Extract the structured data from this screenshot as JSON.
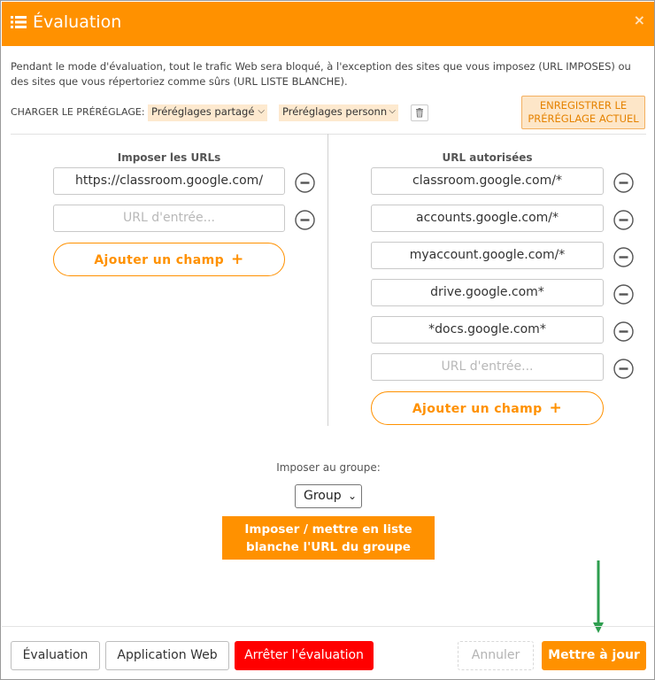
{
  "dialog": {
    "title": "Évaluation",
    "title_icon": "list-icon",
    "close_icon": "close-icon",
    "close_label": "×"
  },
  "description": "Pendant le mode d'évaluation, tout le trafic Web sera bloqué, à l'exception des sites que vous imposez (URL IMPOSES) ou des sites que vous répertoriez comme sûrs (URL LISTE BLANCHE).",
  "presets": {
    "label": "CHARGER LE PRÉRÉGLAGE:",
    "shared_select_value": "Préréglages partagé",
    "personal_select_value": "Préréglages personn",
    "delete_icon": "trash-icon",
    "save_button": "ENREGISTRER LE PRÉRÉGLAGE ACTUEL"
  },
  "imposed": {
    "heading": "Imposer les URLs",
    "urls": [
      "https://classroom.google.com/"
    ],
    "input_placeholder": "URL d'entrée...",
    "add_button": "Ajouter un champ",
    "add_icon": "+"
  },
  "allowed": {
    "heading": "URL autorisées",
    "urls": [
      "classroom.google.com/*",
      "accounts.google.com/*",
      "myaccount.google.com/*",
      "drive.google.com*",
      "*docs.google.com*"
    ],
    "input_placeholder": "URL d'entrée...",
    "add_button": "Ajouter un champ",
    "add_icon": "+"
  },
  "group": {
    "label": "Imposer au groupe:",
    "select_value": "Group",
    "apply_button": "Imposer / mettre en liste blanche l'URL du groupe"
  },
  "footer": {
    "evaluation_button": "Évaluation",
    "webapp_button": "Application Web",
    "stop_button": "Arrêter l'évaluation",
    "cancel_button": "Annuler",
    "update_button": "Mettre à jour"
  },
  "colors": {
    "accent": "#ff9100",
    "danger": "#ff0000",
    "annotation_arrow": "#2e9e4f"
  }
}
